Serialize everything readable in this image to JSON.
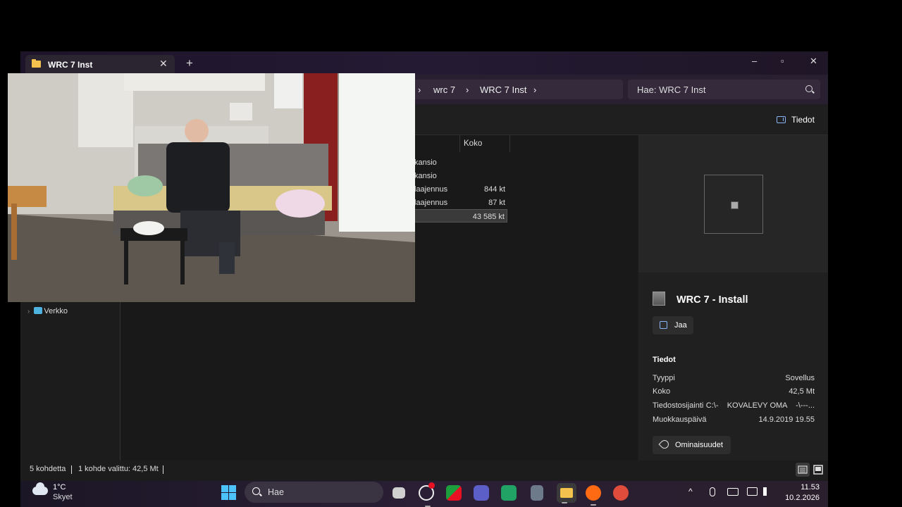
{
  "window": {
    "tab_title": "WRC 7 Inst",
    "new_tab": "+",
    "close_tab": "✕",
    "controls": {
      "minimize": "–",
      "restore": "▫",
      "close": "✕"
    }
  },
  "address": {
    "sep1": "›",
    "crumb1": "wrc 7",
    "sep2": "›",
    "crumb2": "WRC 7 Inst",
    "sep3": "›",
    "search_placeholder": "Hae: WRC 7 Inst"
  },
  "command_bar": {
    "dots": "·",
    "details_label": "Tiedot"
  },
  "file_list": {
    "col_size": "Koko",
    "rows": [
      {
        "type": "kansio",
        "size": ""
      },
      {
        "type": "kansio",
        "size": ""
      },
      {
        "type": "laajennus",
        "size": "844 kt"
      },
      {
        "type": "laajennus",
        "size": "87 kt"
      },
      {
        "type": "",
        "size": "43 585 kt"
      }
    ]
  },
  "nav_pane": {
    "verkko_label": "Verkko"
  },
  "details_pane": {
    "file_name": "WRC 7 - Install",
    "share_label": "Jaa",
    "section_title": "Tiedot",
    "props": {
      "type_label": "Tyyppi",
      "type_value": "Sovellus",
      "size_label": "Koko",
      "size_value": "42,5 Mt",
      "location_label": "Tiedostosijainti",
      "location_value": "C:\\-    KOVALEVY OMA    -\\---...",
      "modified_label": "Muokkauspäivä",
      "modified_value": "14.9.2019 19.55"
    },
    "properties_label": "Ominaisuudet"
  },
  "status_bar": {
    "item_count": "5 kohdetta",
    "selected": "1 kohde valittu: 42,5 Mt"
  },
  "taskbar": {
    "temperature": "1°C",
    "condition": "Skyet",
    "search_label": "Hae",
    "time": "11.53",
    "date": "10.2.2026",
    "tray_chevron": "^"
  },
  "colors": {
    "accent": "#4cc2ff",
    "folder": "#f2c14e",
    "titlebar": "#241a33"
  }
}
